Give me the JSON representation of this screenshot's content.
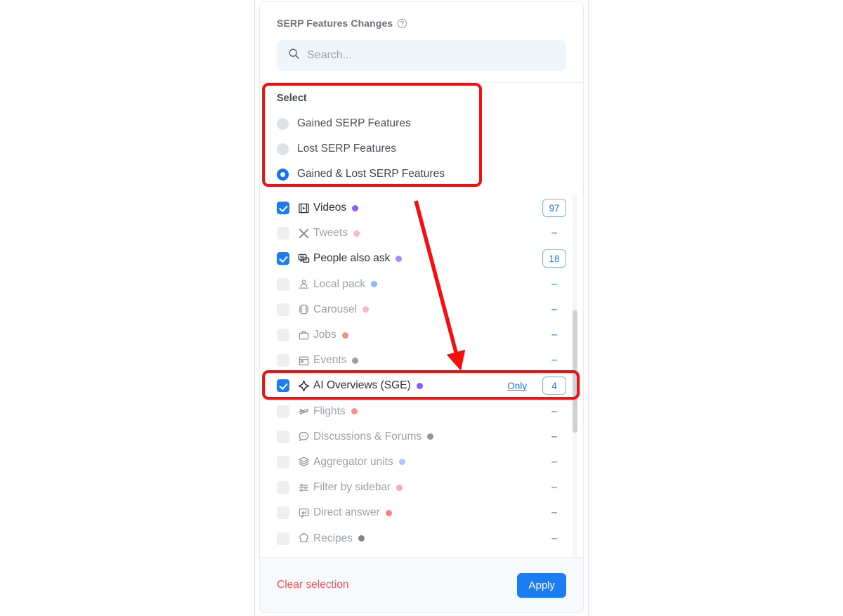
{
  "panel": {
    "header": {
      "title": "SERP Features Changes",
      "help_icon": "question-circle-icon"
    },
    "search": {
      "icon": "search-icon",
      "placeholder": "Search...",
      "value": ""
    },
    "select_group": {
      "title": "Select",
      "options": [
        {
          "label": "Gained SERP Features",
          "selected": false
        },
        {
          "label": "Lost SERP Features",
          "selected": false
        },
        {
          "label": "Gained & Lost SERP Features",
          "selected": true
        }
      ]
    },
    "features": [
      {
        "label": "Videos",
        "icon": "video-player-icon",
        "dot_color": "#8b5cf6",
        "checked": true,
        "count": "97",
        "only_label": ""
      },
      {
        "label": "Tweets",
        "icon": "x-twitter-icon",
        "dot_color": "#f9b8bd",
        "checked": false,
        "count": "–",
        "only_label": ""
      },
      {
        "label": "People also ask",
        "icon": "speech-bubbles-icon",
        "dot_color": "#a78bfa",
        "checked": true,
        "count": "18",
        "only_label": ""
      },
      {
        "label": "Local pack",
        "icon": "map-pin-person-icon",
        "dot_color": "#93b5f0",
        "checked": false,
        "count": "–",
        "only_label": ""
      },
      {
        "label": "Carousel",
        "icon": "carousel-icon",
        "dot_color": "#f7b9bb",
        "checked": false,
        "count": "–",
        "only_label": ""
      },
      {
        "label": "Jobs",
        "icon": "briefcase-icon",
        "dot_color": "#fb8b8b",
        "checked": false,
        "count": "–",
        "only_label": ""
      },
      {
        "label": "Events",
        "icon": "calendar-icon",
        "dot_color": "#9aa0a6",
        "checked": false,
        "count": "–",
        "only_label": ""
      },
      {
        "label": "AI Overviews (SGE)",
        "icon": "sparkle-diamond-icon",
        "dot_color": "#8b5cf6",
        "checked": true,
        "count": "4",
        "only_label": "Only"
      },
      {
        "label": "Flights",
        "icon": "airplane-icon",
        "dot_color": "#fb8f8f",
        "checked": false,
        "count": "–",
        "only_label": ""
      },
      {
        "label": "Discussions & Forums",
        "icon": "chat-dots-icon",
        "dot_color": "#8e959b",
        "checked": false,
        "count": "–",
        "only_label": ""
      },
      {
        "label": "Aggregator units",
        "icon": "layers-icon",
        "dot_color": "#a8cbf5",
        "checked": false,
        "count": "–",
        "only_label": ""
      },
      {
        "label": "Filter by sidebar",
        "icon": "sliders-icon",
        "dot_color": "#f7a8c4",
        "checked": false,
        "count": "–",
        "only_label": ""
      },
      {
        "label": "Direct answer",
        "icon": "answer-box-icon",
        "dot_color": "#fb8080",
        "checked": false,
        "count": "–",
        "only_label": ""
      },
      {
        "label": "Recipes",
        "icon": "chef-hat-icon",
        "dot_color": "#7e858b",
        "checked": false,
        "count": "–",
        "only_label": ""
      }
    ],
    "footer": {
      "clear_label": "Clear selection",
      "apply_label": "Apply"
    }
  },
  "colors": {
    "accent_blue": "#1a7ef2",
    "annotation_red": "#f41010",
    "clear_red": "#ff4d4f"
  }
}
